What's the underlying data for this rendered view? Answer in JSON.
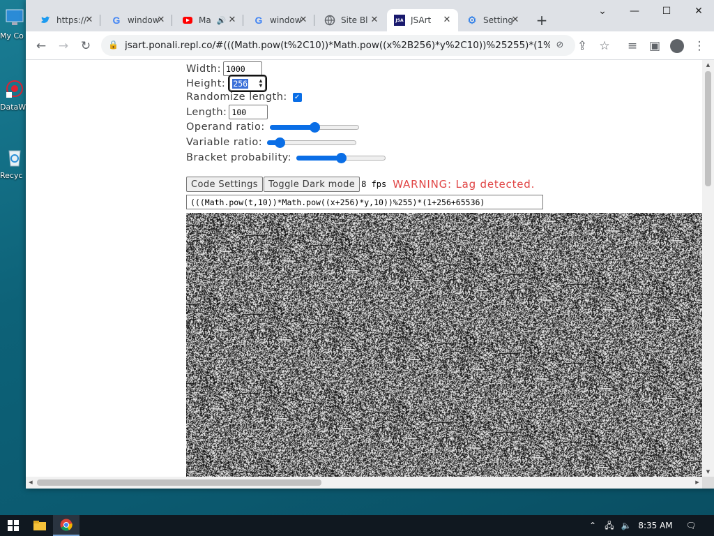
{
  "desktop": {
    "icons": [
      {
        "label": "My Co",
        "icon": "computer-icon"
      },
      {
        "label": "DataW",
        "icon": "datawrapper-icon"
      },
      {
        "label": "Recyc",
        "icon": "recycle-bin-icon"
      }
    ]
  },
  "browser": {
    "tabs": [
      {
        "label": "https://",
        "icon": "twitter-icon",
        "active": false
      },
      {
        "label": "window",
        "icon": "google-icon",
        "active": false
      },
      {
        "label": "Ma",
        "icon": "youtube-icon",
        "active": false
      },
      {
        "label": "window",
        "icon": "google-icon",
        "active": false
      },
      {
        "label": "Site Bl",
        "icon": "globe-icon",
        "active": false
      },
      {
        "label": "JSArt",
        "icon": "jsart-icon",
        "active": true
      },
      {
        "label": "Setting",
        "icon": "gear-icon",
        "active": false
      }
    ],
    "url": "jsart.ponali.repl.co/#(((Math.pow(t%2C10))*Math.pow((x%2B256)*y%2C10))%25255)*(1%2B256%..."
  },
  "page": {
    "width_label": "Width:",
    "width_value": "1000",
    "height_label": "Height:",
    "height_value": "256",
    "randomize_label": "Randomize length:",
    "randomize_checked": true,
    "length_label": "Length:",
    "length_value": "100",
    "operand_label": "Operand ratio:",
    "operand_value": 0.5,
    "variable_label": "Variable ratio:",
    "variable_value": 0.1,
    "bracket_label": "Bracket probability:",
    "bracket_value": 0.5,
    "code_settings_label": "Code Settings",
    "dark_mode_label": "Toggle Dark mode",
    "fps_text": "8 fps",
    "warning_text": "WARNING: Lag detected.",
    "code": "(((Math.pow(t,10))*Math.pow((x+256)*y,10))%255)*(1+256+65536)"
  },
  "taskbar": {
    "time": "8:35 AM"
  },
  "colors": {
    "accent": "#0a6ee6",
    "warning": "#e04343"
  }
}
